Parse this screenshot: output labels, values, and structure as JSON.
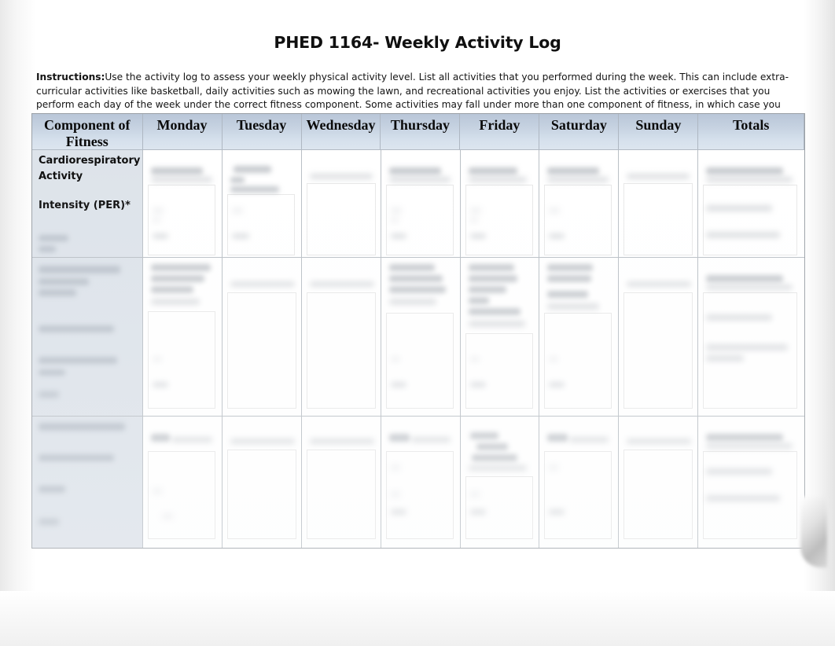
{
  "document": {
    "title": "PHED 1164- Weekly Activity Log",
    "instructions_label": "Instructions:",
    "instructions_body": "Use the activity log to assess your weekly physical activity level.  List all activities that you performed during the week.  This can include extra-curricular activities like basketball, daily activities such as mowing the lawn, and recreational activities you enjoy.  List the activities or exercises that you perform each day of the week under the correct fitness component. Some activities may fall under more than one component of fitness, in which case you should indicate the time spent in each category"
  },
  "table": {
    "headers": [
      "Component of Fitness",
      "Monday",
      "Tuesday",
      "Wednesday",
      "Thursday",
      "Friday",
      "Saturday",
      "Sunday",
      "Totals"
    ],
    "rows": [
      {
        "component": "Cardiorespiratory Activity",
        "component_sub": "Intensity (PER)*",
        "cells": [
          "",
          "",
          "",
          "",
          "",
          "",
          "",
          ""
        ]
      },
      {
        "component": "",
        "component_sub": "",
        "cells": [
          "",
          "",
          "",
          "",
          "",
          "",
          "",
          ""
        ]
      },
      {
        "component": "",
        "component_sub": "",
        "cells": [
          "",
          "",
          "",
          "",
          "",
          "",
          "",
          ""
        ]
      }
    ]
  },
  "colors": {
    "header_gradient_top": "#b9c6d8",
    "header_gradient_bottom": "#dce5ef",
    "component_column_bg": "#dde3ea",
    "cell_bg": "#ffffff",
    "grid_line": "#b9bfc5",
    "text": "#0a0a0a"
  }
}
